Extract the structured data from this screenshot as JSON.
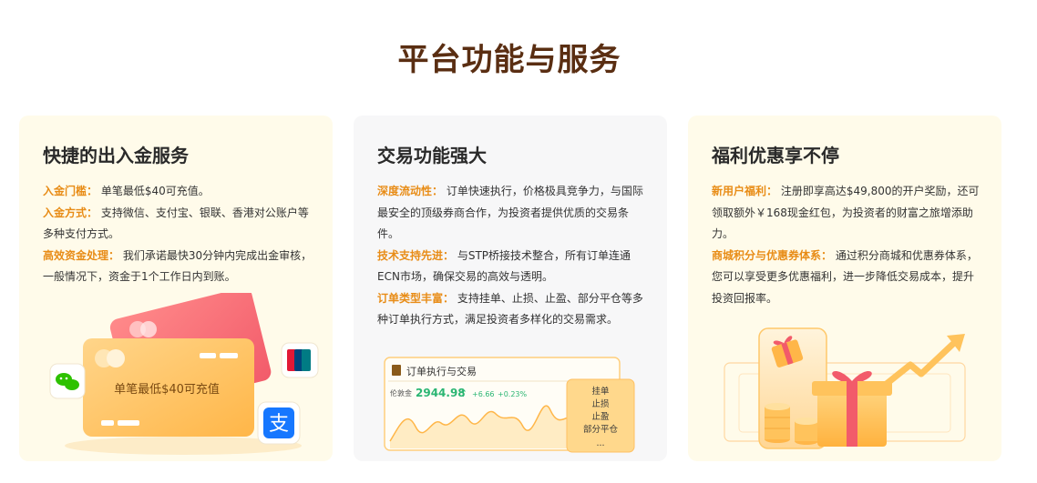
{
  "page_title": "平台功能与服务",
  "cards": [
    {
      "title": "快捷的出入金服务",
      "items": [
        {
          "label": "入金门槛：",
          "text": "单笔最低$40可充值。"
        },
        {
          "label": "入金方式：",
          "text": "支持微信、支付宝、银联、香港对公账户等多种支付方式。"
        },
        {
          "label": "高效资金处理：",
          "text": "我们承诺最快30分钟内完成出金审核，一般情况下，资金于1个工作日内到账。"
        }
      ],
      "illustration": {
        "card_text": "单笔最低$40可充值",
        "wechat_icon": "wechat-icon",
        "unionpay_icon": "unionpay-icon",
        "unionpay_text": "UnionPay 银联",
        "alipay_icon": "alipay-icon",
        "alipay_glyph": "支"
      }
    },
    {
      "title": "交易功能强大",
      "items": [
        {
          "label": "深度流动性：",
          "text": "订单快速执行，价格极具竞争力，与国际最安全的顶级券商合作，为投资者提供优质的交易条件。"
        },
        {
          "label": "技术支持先进：",
          "text": "与STP桥接技术整合，所有订单连通ECN市场，确保交易的高效与透明。"
        },
        {
          "label": "订单类型丰富：",
          "text": "支持挂单、止损、止盈、部分平仓等多种订单执行方式，满足投资者多样化的交易需求。"
        }
      ],
      "illustration": {
        "panel_title": "订单执行与交易",
        "symbol": "伦敦金",
        "price": "2944.98",
        "change": "+6.66",
        "change_pct": "+0.23%",
        "order_types": [
          "挂单",
          "止损",
          "止盈",
          "部分平仓",
          "..."
        ]
      }
    },
    {
      "title": "福利优惠享不停",
      "items": [
        {
          "label": "新用户福利：",
          "text": "注册即享高达$49,800的开户奖励，还可领取额外￥168现金红包，为投资者的财富之旅增添助力。"
        },
        {
          "label": "商城积分与优惠券体系：",
          "text": "通过积分商城和优惠券体系，您可以享受更多优惠福利，进一步降低交易成本，提升投资回报率。"
        }
      ]
    }
  ],
  "colors": {
    "title": "#5a2e12",
    "highlight": "#e88c16",
    "card_warm": "#fffbea",
    "card_gray": "#f7f7f8",
    "gold": "#ffc062",
    "rise": "#2bb673"
  }
}
